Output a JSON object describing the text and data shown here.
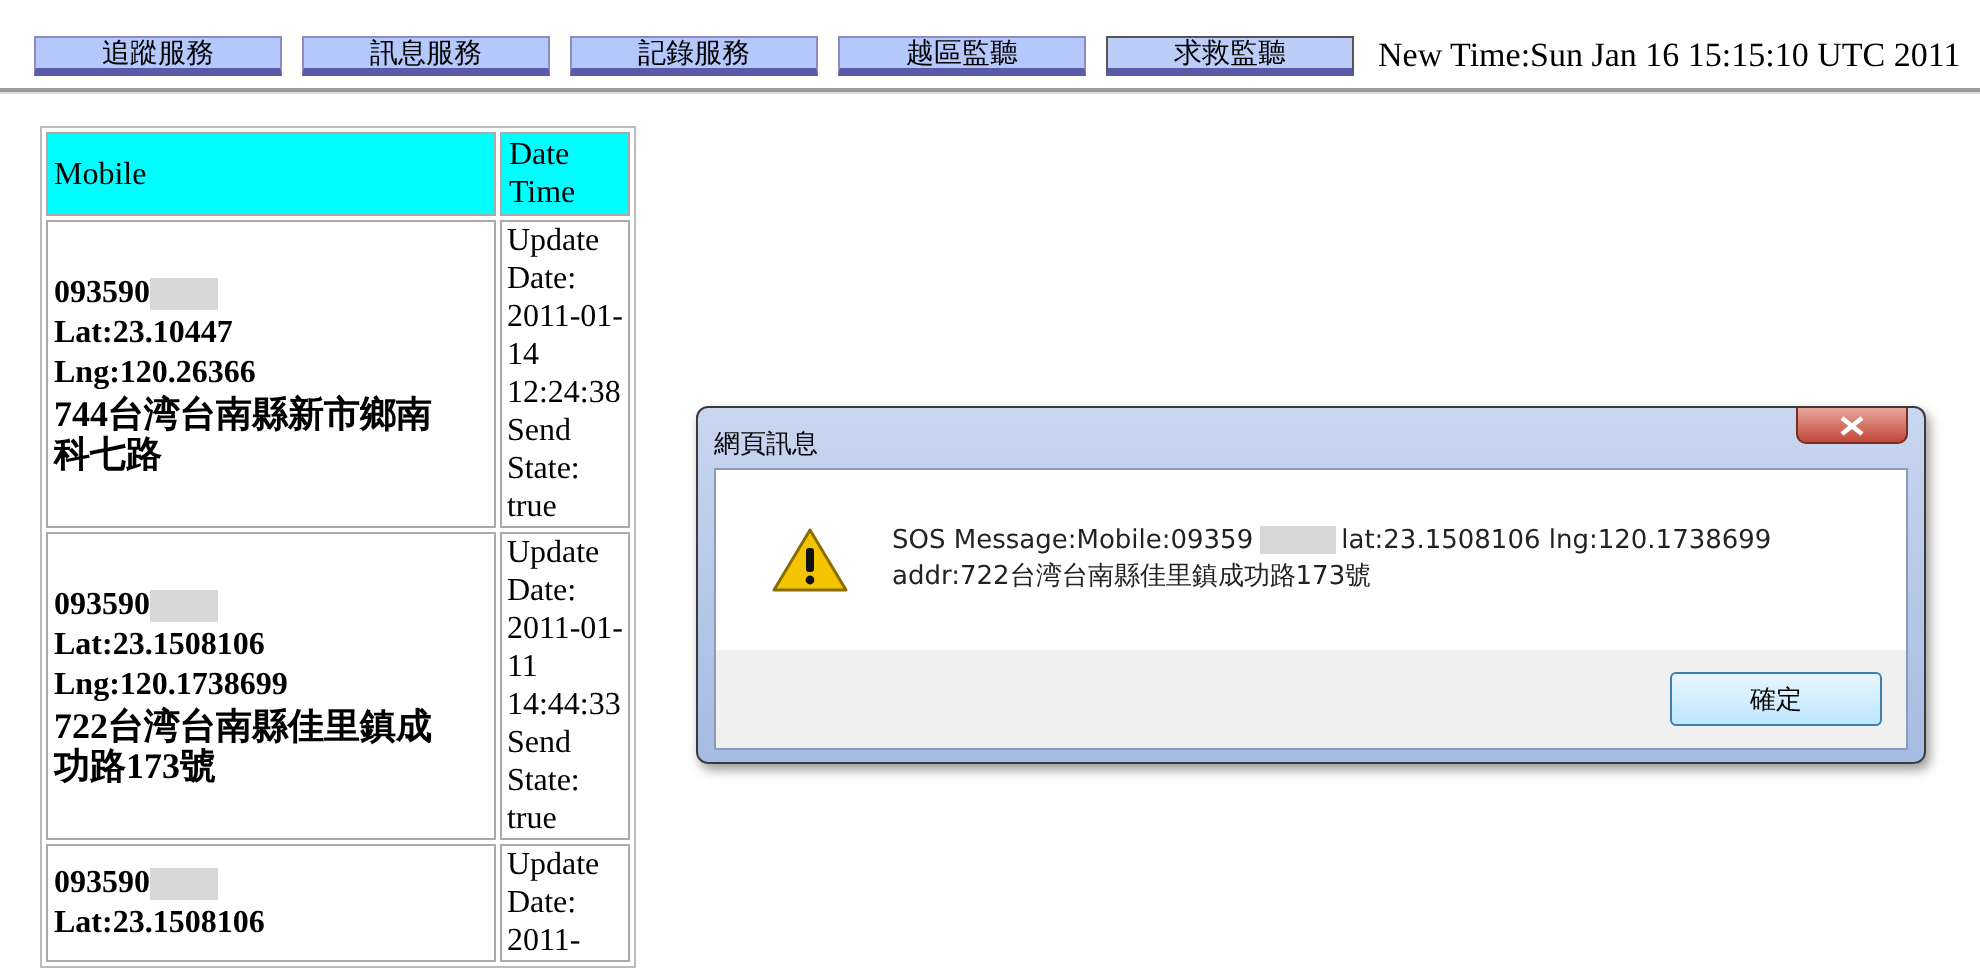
{
  "nav": [
    {
      "label": "追蹤服務",
      "selected": false
    },
    {
      "label": "訊息服務",
      "selected": false
    },
    {
      "label": "記錄服務",
      "selected": false
    },
    {
      "label": "越區監聽",
      "selected": false
    },
    {
      "label": "求救監聽",
      "selected": true
    }
  ],
  "time": "New Time:Sun Jan 16 15:15:10 UTC 2011",
  "table": {
    "columns": [
      "Mobile",
      "Date Time"
    ],
    "rows": [
      {
        "mobile": "093590",
        "lat": "Lat:23.10447",
        "lng": "Lng:120.26366",
        "address": "744台湾台南縣新市鄉南科七路",
        "date_time": "Update Date: 2011-01-14 12:24:38 Send State: true"
      },
      {
        "mobile": "093590",
        "lat": "Lat:23.1508106",
        "lng": "Lng:120.1738699",
        "address": "722台湾台南縣佳里鎮成功路173號",
        "date_time": "Update Date: 2011-01-11 14:44:33 Send State: true"
      },
      {
        "mobile": "093590",
        "lat": "Lat:23.1508106",
        "date_time": "Update Date: 2011-"
      }
    ]
  },
  "dialog": {
    "title": "網頁訊息",
    "message_start": "SOS Message:Mobile:09359",
    "message_end": "lat:23.1508106 lng:120.1738699",
    "message_line2": "addr:722台湾台南縣佳里鎮成功路173號",
    "button": "確定"
  }
}
